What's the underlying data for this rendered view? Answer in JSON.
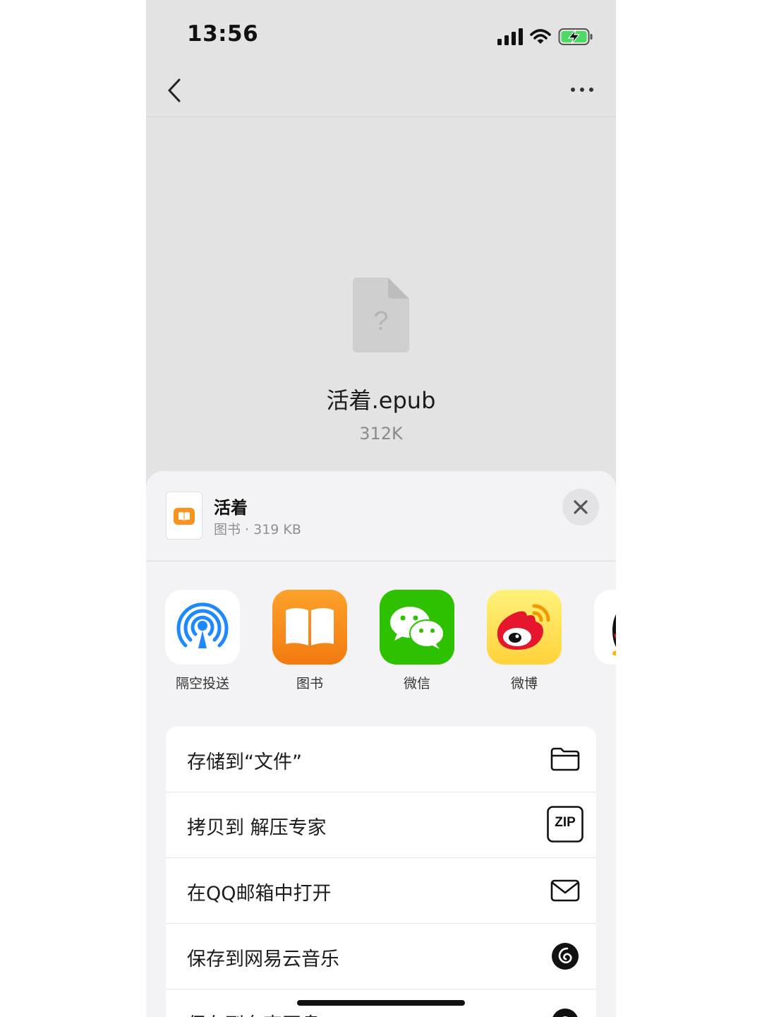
{
  "status_bar": {
    "time": "13:56"
  },
  "preview": {
    "file_name": "活着.epub",
    "file_size": "312K"
  },
  "share_sheet": {
    "title": "活着",
    "subtitle": "图书 · 319 KB",
    "apps": [
      {
        "label": "隔空投送",
        "icon": "airdrop-icon"
      },
      {
        "label": "图书",
        "icon": "books-icon"
      },
      {
        "label": "微信",
        "icon": "wechat-icon"
      },
      {
        "label": "微博",
        "icon": "weibo-icon"
      }
    ],
    "actions": [
      {
        "label": "存储到“文件”",
        "icon": "folder-icon"
      },
      {
        "label": "拷贝到 解压专家",
        "icon": "zip-icon",
        "icon_text": "ZIP"
      },
      {
        "label": "在QQ邮箱中打开",
        "icon": "mail-icon"
      },
      {
        "label": "保存到网易云音乐",
        "icon": "netease-music-icon"
      },
      {
        "label": "保存到夸克网盘",
        "icon": "quark-icon"
      }
    ]
  },
  "colors": {
    "battery_green": "#4cd964",
    "books_orange": "#f7931e",
    "wechat_green": "#2dc100",
    "airdrop_blue": "#1e88ff"
  }
}
